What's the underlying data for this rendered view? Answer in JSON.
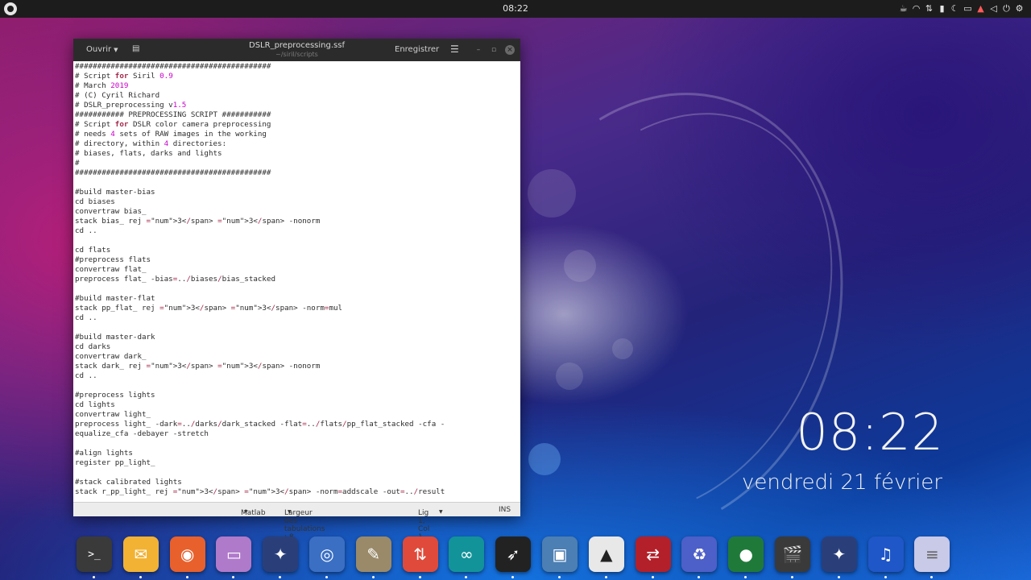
{
  "top_panel": {
    "clock": "08:22",
    "tray_icons": [
      "tea-icon",
      "wifi-icon",
      "network-icon",
      "battery-icon",
      "night-mode-icon",
      "folder-icon",
      "notification-icon",
      "volume-icon",
      "power-icon",
      "settings-icon"
    ]
  },
  "window": {
    "title": "DSLR_preprocessing.ssf",
    "subtitle": "~/siril/scripts",
    "open_label": "Ouvrir",
    "save_label": "Enregistrer",
    "menu_icon": "hamburger-icon",
    "minimize_label": "–",
    "maximize_label": "▫",
    "close_label": "×"
  },
  "editor": {
    "lines": [
      "############################################",
      "# Script for Siril 0.9",
      "# March 2019",
      "# (C) Cyril Richard",
      "# DSLR_preprocessing v1.5",
      "########### PREPROCESSING SCRIPT ###########",
      "# Script for DSLR color camera preprocessing",
      "# needs 4 sets of RAW images in the working",
      "# directory, within 4 directories:",
      "# biases, flats, darks and lights",
      "#",
      "############################################",
      "",
      "#build master-bias",
      "cd biases",
      "convertraw bias_",
      "stack bias_ rej 3 3 -nonorm",
      "cd ..",
      "",
      "cd flats",
      "#preprocess flats",
      "convertraw flat_",
      "preprocess flat_ -bias=../biases/bias_stacked",
      "",
      "#build master-flat",
      "stack pp_flat_ rej 3 3 -norm=mul",
      "cd ..",
      "",
      "#build master-dark",
      "cd darks",
      "convertraw dark_",
      "stack dark_ rej 3 3 -nonorm",
      "cd ..",
      "",
      "#preprocess lights",
      "cd lights",
      "convertraw light_",
      "preprocess light_ -dark=../darks/dark_stacked -flat=../flats/pp_flat_stacked -cfa -",
      "equalize_cfa -debayer -stretch",
      "",
      "#align lights",
      "register pp_light_",
      "",
      "#stack calibrated lights",
      "stack r_pp_light_ rej 3 3 -norm=addscale -out=../result"
    ]
  },
  "statusbar": {
    "language": "Matlab",
    "tab_width": "Largeur des tabulations : 8",
    "position": "Lig 1, Col 1",
    "mode": "INS"
  },
  "desktop_clock": {
    "time": "08:22",
    "date": "vendredi 21 février"
  },
  "dock": {
    "items": [
      {
        "name": "terminal",
        "glyph": ">_",
        "color": "#3a3a3a"
      },
      {
        "name": "mail",
        "glyph": "✉",
        "color": "#f2b233"
      },
      {
        "name": "firefox",
        "glyph": "◉",
        "color": "#e8602c"
      },
      {
        "name": "files",
        "glyph": "▭",
        "color": "#b07acb"
      },
      {
        "name": "stellarium",
        "glyph": "✦",
        "color": "#2a3f7a"
      },
      {
        "name": "camera",
        "glyph": "◎",
        "color": "#3a6fc4"
      },
      {
        "name": "gimp",
        "glyph": "✎",
        "color": "#9a8a6a"
      },
      {
        "name": "upload-download",
        "glyph": "⇅",
        "color": "#e04a3a"
      },
      {
        "name": "arduino",
        "glyph": "∞",
        "color": "#12939a"
      },
      {
        "name": "hawk",
        "glyph": "➶",
        "color": "#222222"
      },
      {
        "name": "screen-recorder",
        "glyph": "▣",
        "color": "#4c7fb3"
      },
      {
        "name": "inkscape",
        "glyph": "▲",
        "color": "#e8e8e8"
      },
      {
        "name": "filezilla",
        "glyph": "⇄",
        "color": "#b3202a"
      },
      {
        "name": "recycle",
        "glyph": "♻",
        "color": "#4d5fc8"
      },
      {
        "name": "radar",
        "glyph": "●",
        "color": "#1f7a3a"
      },
      {
        "name": "video-editor",
        "glyph": "🎬",
        "color": "#3a3a3a"
      },
      {
        "name": "siril",
        "glyph": "✦",
        "color": "#2a3f7a"
      },
      {
        "name": "audacity",
        "glyph": "♫",
        "color": "#1f57c8"
      },
      {
        "name": "text-editor",
        "glyph": "≡",
        "color": "#c9c9e8"
      }
    ]
  }
}
